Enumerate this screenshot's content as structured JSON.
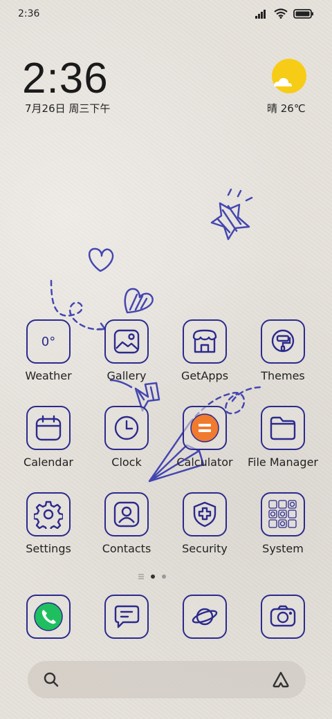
{
  "status_bar": {
    "time": "2:36"
  },
  "clock_widget": {
    "time": "2:36",
    "date": "7月26日 周三下午"
  },
  "weather_widget": {
    "text": "晴 26℃"
  },
  "apps": [
    {
      "label": "Weather",
      "icon": "weather-icon",
      "tile_text": "0°"
    },
    {
      "label": "Gallery",
      "icon": "gallery-icon"
    },
    {
      "label": "GetApps",
      "icon": "store-icon"
    },
    {
      "label": "Themes",
      "icon": "paint-roller-icon"
    },
    {
      "label": "Calendar",
      "icon": "calendar-icon"
    },
    {
      "label": "Clock",
      "icon": "clock-icon"
    },
    {
      "label": "Calculator",
      "icon": "calculator-icon"
    },
    {
      "label": "File Manager",
      "icon": "folder-icon"
    },
    {
      "label": "Settings",
      "icon": "gear-icon"
    },
    {
      "label": "Contacts",
      "icon": "contact-icon"
    },
    {
      "label": "Security",
      "icon": "shield-icon"
    },
    {
      "label": "System",
      "icon": "folder-grid-icon"
    }
  ],
  "dock": [
    {
      "name": "phone",
      "icon": "phone-icon"
    },
    {
      "name": "messages",
      "icon": "message-icon"
    },
    {
      "name": "browser",
      "icon": "planet-icon"
    },
    {
      "name": "camera",
      "icon": "camera-icon"
    }
  ],
  "colors": {
    "accent": "#2b2a8c",
    "phone_green": "#1fbf5f",
    "calc_orange": "#f07a2e",
    "sun_yellow": "#f7cc17"
  }
}
